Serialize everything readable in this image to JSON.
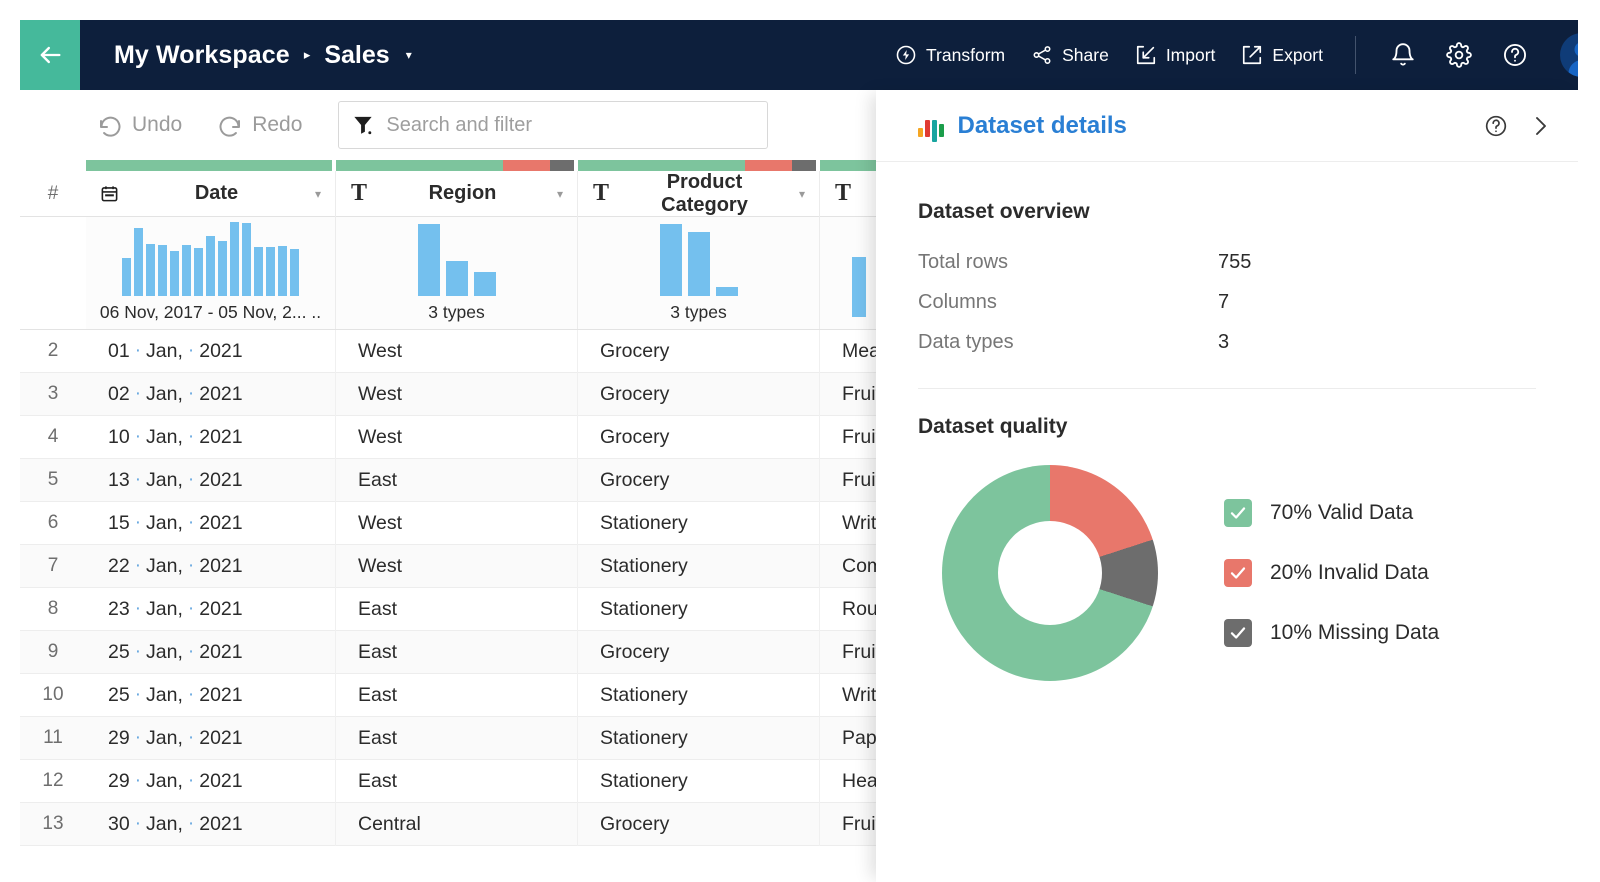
{
  "header": {
    "back_icon": "arrow-left-icon",
    "breadcrumb_root": "My Workspace",
    "breadcrumb_separator": "▸",
    "breadcrumb_current": "Sales",
    "breadcrumb_caret": "▾",
    "actions": [
      {
        "label": "Transform",
        "icon": "transform-icon"
      },
      {
        "label": "Share",
        "icon": "share-icon"
      },
      {
        "label": "Import",
        "icon": "import-icon"
      },
      {
        "label": "Export",
        "icon": "export-icon"
      }
    ],
    "icons": [
      {
        "name": "notifications-bell-icon"
      },
      {
        "name": "settings-gear-icon"
      },
      {
        "name": "help-circle-icon"
      },
      {
        "name": "user-avatar"
      }
    ],
    "bar_color": "#0d1f3c",
    "back_color": "#45b99b"
  },
  "toolbar": {
    "undo_label": "Undo",
    "redo_label": "Redo",
    "undo_icon": "undo-arrow-icon",
    "redo_icon": "redo-arrow-icon",
    "filter_icon": "funnel-filter-icon",
    "search_placeholder": "Search and filter",
    "search_value": ""
  },
  "grid": {
    "row_number_header": "#",
    "columns": [
      {
        "name": "Date",
        "type_icon": "calendar-icon",
        "type_letter": "",
        "caret": "▾",
        "quality": [
          100,
          0,
          0
        ],
        "summary": "06 Nov, 2017 - 05 Nov, 2... ..",
        "histogram": [
          38,
          68,
          52,
          51,
          45,
          51,
          48,
          60,
          55,
          74,
          73,
          49,
          49,
          50,
          47
        ]
      },
      {
        "name": "Region",
        "type_icon": "text-type-icon",
        "type_letter": "T",
        "caret": "▾",
        "quality": [
          70,
          20,
          10
        ],
        "summary": "3 types",
        "histogram": [
          72,
          35,
          24
        ]
      },
      {
        "name": "Product Category",
        "type_icon": "text-type-icon",
        "type_letter": "T",
        "caret": "▾",
        "quality": [
          70,
          20,
          10
        ],
        "summary": "3 types",
        "histogram": [
          72,
          64,
          9
        ]
      },
      {
        "name": "",
        "type_icon": "text-type-icon",
        "type_letter": "T",
        "caret": "",
        "quality": [
          100,
          0,
          0
        ],
        "summary": "",
        "histogram": [
          60
        ]
      }
    ],
    "rows": [
      {
        "n": "2",
        "date_day": "01",
        "date_month": "Jan,",
        "date_year": "2021",
        "region": "West",
        "category": "Grocery",
        "item": "Meat"
      },
      {
        "n": "3",
        "date_day": "02",
        "date_month": "Jan,",
        "date_year": "2021",
        "region": "West",
        "category": "Grocery",
        "item": "Fruit"
      },
      {
        "n": "4",
        "date_day": "10",
        "date_month": "Jan,",
        "date_year": "2021",
        "region": "West",
        "category": "Grocery",
        "item": "Fruit"
      },
      {
        "n": "5",
        "date_day": "13",
        "date_month": "Jan,",
        "date_year": "2021",
        "region": "East",
        "category": "Grocery",
        "item": "Fruit"
      },
      {
        "n": "6",
        "date_day": "15",
        "date_month": "Jan,",
        "date_year": "2021",
        "region": "West",
        "category": "Stationery",
        "item": "Writ"
      },
      {
        "n": "7",
        "date_day": "22",
        "date_month": "Jan,",
        "date_year": "2021",
        "region": "West",
        "category": "Stationery",
        "item": "Com"
      },
      {
        "n": "8",
        "date_day": "23",
        "date_month": "Jan,",
        "date_year": "2021",
        "region": "East",
        "category": "Stationery",
        "item": "Roun"
      },
      {
        "n": "9",
        "date_day": "25",
        "date_month": "Jan,",
        "date_year": "2021",
        "region": "East",
        "category": "Grocery",
        "item": "Fruit"
      },
      {
        "n": "10",
        "date_day": "25",
        "date_month": "Jan,",
        "date_year": "2021",
        "region": "East",
        "category": "Stationery",
        "item": "Writ"
      },
      {
        "n": "11",
        "date_day": "29",
        "date_month": "Jan,",
        "date_year": "2021",
        "region": "East",
        "category": "Stationery",
        "item": "Pape"
      },
      {
        "n": "12",
        "date_day": "29",
        "date_month": "Jan,",
        "date_year": "2021",
        "region": "East",
        "category": "Stationery",
        "item": "Heav"
      },
      {
        "n": "13",
        "date_day": "30",
        "date_month": "Jan,",
        "date_year": "2021",
        "region": "Central",
        "category": "Grocery",
        "item": "Fruit"
      }
    ]
  },
  "panel": {
    "icon": "dataset-bars-icon",
    "title": "Dataset details",
    "help_icon": "help-circle-icon",
    "collapse_icon": "chevron-right-icon",
    "overview_title": "Dataset overview",
    "stats": [
      {
        "key": "Total rows",
        "value": "755"
      },
      {
        "key": "Columns",
        "value": "7"
      },
      {
        "key": "Data types",
        "value": "3"
      }
    ],
    "quality_title": "Dataset quality",
    "legend": [
      {
        "label": "70% Valid Data",
        "color": "#7dc49d",
        "checked": true
      },
      {
        "label": "20% Invalid Data",
        "color": "#e8776b",
        "checked": true
      },
      {
        "label": "10% Missing Data",
        "color": "#6d6d6d",
        "checked": true
      }
    ]
  },
  "chart_data": {
    "type": "pie",
    "title": "Dataset quality",
    "categories": [
      "Valid Data",
      "Invalid Data",
      "Missing Data"
    ],
    "values": [
      70,
      20,
      10
    ],
    "colors": [
      "#7dc49d",
      "#e8776b",
      "#6d6d6d"
    ],
    "legend_position": "right",
    "donut": true
  },
  "colors": {
    "valid": "#7dc49d",
    "invalid": "#e8776b",
    "missing": "#6d6d6d",
    "accent_blue": "#2a7fd4",
    "histogram_bar": "#74c0ee",
    "navy": "#0d1f3c",
    "teal": "#45b99b"
  }
}
